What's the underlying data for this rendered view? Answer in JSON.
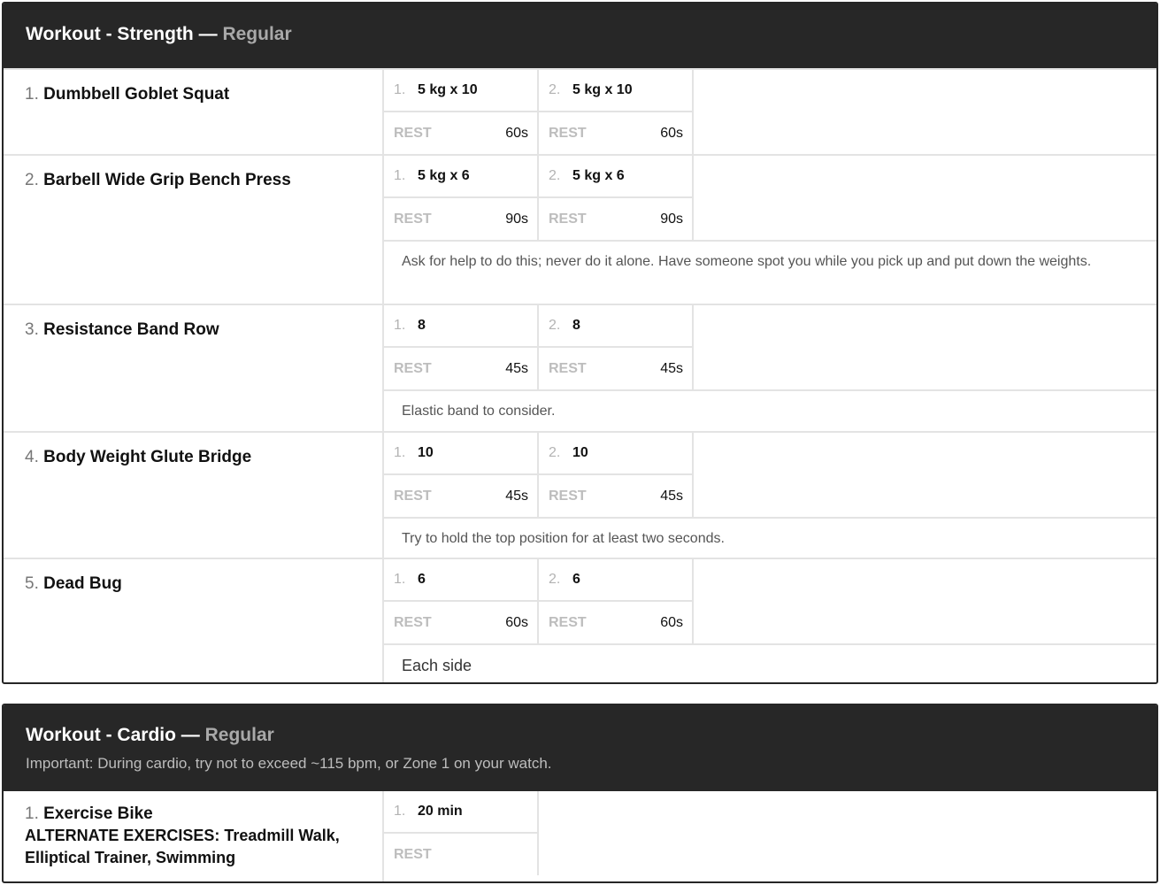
{
  "strength": {
    "title": "Workout - Strength",
    "dash": " — ",
    "variant": "Regular",
    "rest_label": "REST",
    "exercises": [
      {
        "num": "1.",
        "name": "Dumbbell Goblet Squat",
        "sets": [
          {
            "idx": "1.",
            "value": "5 kg x 10",
            "rest": "60s"
          },
          {
            "idx": "2.",
            "value": "5 kg x 10",
            "rest": "60s"
          }
        ],
        "note": ""
      },
      {
        "num": "2.",
        "name": "Barbell Wide Grip Bench Press",
        "sets": [
          {
            "idx": "1.",
            "value": "5 kg x 6",
            "rest": "90s"
          },
          {
            "idx": "2.",
            "value": "5 kg x 6",
            "rest": "90s"
          }
        ],
        "note": "Ask for help to do this; never do it alone. Have someone spot you while you pick up and put down the weights."
      },
      {
        "num": "3.",
        "name": "Resistance Band Row",
        "sets": [
          {
            "idx": "1.",
            "value": "8",
            "rest": "45s"
          },
          {
            "idx": "2.",
            "value": "8",
            "rest": "45s"
          }
        ],
        "note": "Elastic band to consider."
      },
      {
        "num": "4.",
        "name": "Body Weight Glute Bridge",
        "sets": [
          {
            "idx": "1.",
            "value": "10",
            "rest": "45s"
          },
          {
            "idx": "2.",
            "value": "10",
            "rest": "45s"
          }
        ],
        "note": "Try to hold the top position for at least two seconds."
      },
      {
        "num": "5.",
        "name": "Dead Bug",
        "sets": [
          {
            "idx": "1.",
            "value": "6",
            "rest": "60s"
          },
          {
            "idx": "2.",
            "value": "6",
            "rest": "60s"
          }
        ],
        "note": "Each side"
      }
    ]
  },
  "cardio": {
    "title": "Workout - Cardio",
    "dash": " — ",
    "variant": "Regular",
    "note": "Important: During cardio, try not to exceed ~115 bpm, or Zone 1 on your watch.",
    "rest_label": "REST",
    "exercise": {
      "num": "1.",
      "name": "Exercise Bike",
      "alternates": "ALTERNATE EXERCISES:  Treadmill Walk, Elliptical Trainer, Swimming",
      "set": {
        "idx": "1.",
        "value": "20 min",
        "rest": ""
      }
    }
  }
}
